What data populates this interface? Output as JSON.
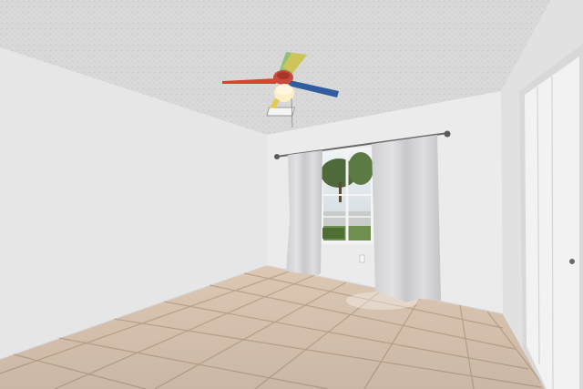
{
  "scene": {
    "alt": "",
    "colors": {
      "ceiling": "#dcdcdc",
      "wall_left": "#e8e8e8",
      "wall_back": "#ececec",
      "wall_right": "#e3e3e3",
      "floor_tile": "#d9c4b0",
      "grout": "#bfa891",
      "curtain": "#d6d6d8",
      "window_frame": "#f4f4f4",
      "fan_blade_red": "#d8452f",
      "fan_blade_blue": "#2f5d9e",
      "fan_blade_green": "#8fc07a",
      "fan_blade_yellow": "#e8c84a",
      "closet_door": "#f1f1f1"
    },
    "objects": [
      "ceiling-fan-icon",
      "window",
      "curtain-left",
      "curtain-right",
      "closet-door",
      "air-vent",
      "tile-floor"
    ]
  }
}
